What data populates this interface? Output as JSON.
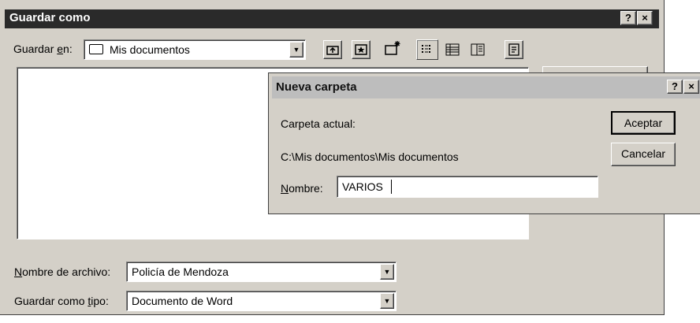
{
  "save_dialog": {
    "title": "Guardar como",
    "help_button": "?",
    "close_button": "×",
    "save_in": {
      "label_pre": "Guardar ",
      "label_accel": "e",
      "label_post": "n:",
      "value": "Mis documentos"
    },
    "toolbar_icons": [
      "up-folder-icon",
      "desktop-icon",
      "new-folder-icon",
      "list-view-icon",
      "details-view-icon",
      "properties-view-icon",
      "tools-icon"
    ],
    "filename": {
      "label_accel": "N",
      "label_rest": "ombre de archivo:",
      "value": "Policía de Mendoza"
    },
    "filetype": {
      "label_pre": "Guardar como ",
      "label_accel": "t",
      "label_post": "ipo:",
      "value": "Documento de Word"
    }
  },
  "new_folder_dialog": {
    "title": "Nueva carpeta",
    "help_button": "?",
    "close_button": "×",
    "current_folder_label": "Carpeta actual:",
    "current_folder_path": "C:\\Mis documentos\\Mis documentos",
    "name_label_accel": "N",
    "name_label_rest": "ombre:",
    "name_value": "VARIOS",
    "accept_button": "Aceptar",
    "cancel_button": "Cancelar"
  }
}
